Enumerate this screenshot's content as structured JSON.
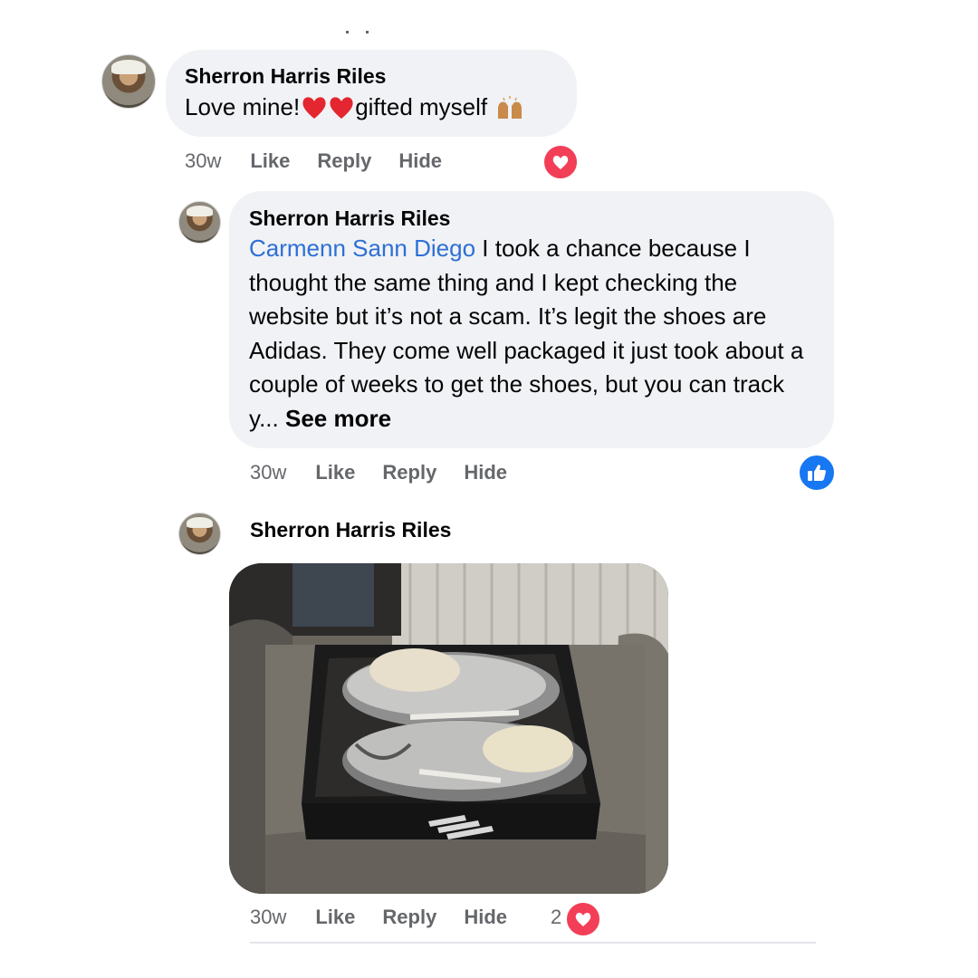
{
  "comments": [
    {
      "author": "Sherron Harris Riles",
      "text": "Love mine!",
      "text_after_emoji": "gifted myself",
      "emojis": [
        "red-heart-emoji",
        "red-heart-emoji",
        "raising-hands-emoji"
      ],
      "time": "30w",
      "like": "Like",
      "reply": "Reply",
      "hide": "Hide",
      "reaction": "love-reaction-icon"
    },
    {
      "author": "Sherron Harris Riles",
      "mention": "Carmenn Sann Diego",
      "text": " I took a chance because I thought the same thing and I kept checking the website but it’s not a scam. It’s legit the shoes are Adidas. They come well packaged it just took about a couple of weeks to get the shoes, but you can track y...",
      "see_more": "See more",
      "time": "30w",
      "like": "Like",
      "reply": "Reply",
      "hide": "Hide",
      "reaction": "like-reaction-icon"
    },
    {
      "author": "Sherron Harris Riles",
      "image": "photo of silver sneakers in a shoe box on a couch",
      "time": "30w",
      "like": "Like",
      "reply": "Reply",
      "hide": "Hide",
      "reaction_count": "2",
      "reaction": "love-reaction-icon"
    }
  ],
  "colors": {
    "bubble": "#f0f2f5",
    "meta_text": "#65676b",
    "mention": "#2d6fd5",
    "love": "#f33e58",
    "like": "#1877f2"
  }
}
